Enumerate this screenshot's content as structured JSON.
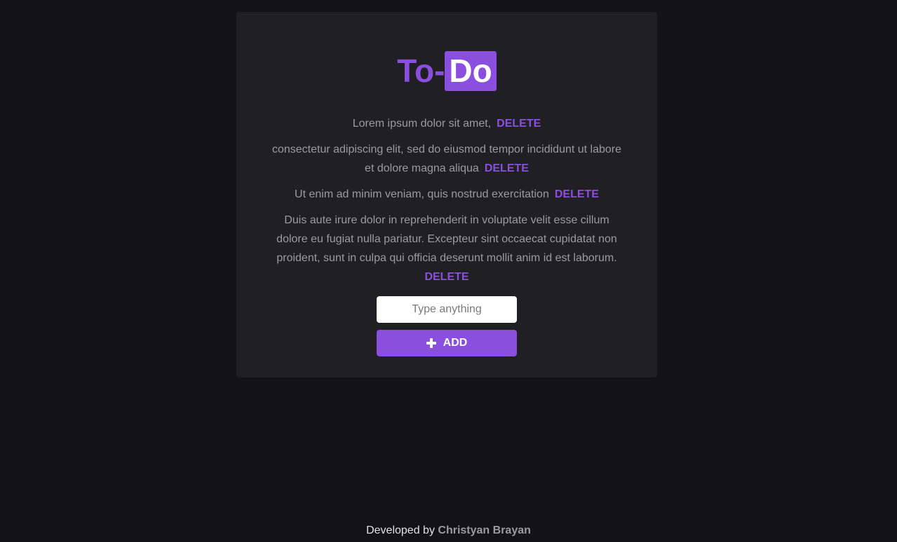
{
  "logo": {
    "part1": "To-",
    "part2": "Do"
  },
  "todos": [
    {
      "text": "Lorem ipsum dolor sit amet,",
      "delete_label": "DELETE"
    },
    {
      "text": "consectetur adipiscing elit, sed do eiusmod tempor incididunt ut labore et dolore magna aliqua",
      "delete_label": "DELETE"
    },
    {
      "text": "Ut enim ad minim veniam, quis nostrud exercitation",
      "delete_label": "DELETE"
    },
    {
      "text": "Duis aute irure dolor in reprehenderit in voluptate velit esse cillum dolore eu fugiat nulla pariatur. Excepteur sint occaecat cupidatat non proident, sunt in culpa qui officia deserunt mollit anim id est laborum.",
      "delete_label": "DELETE"
    }
  ],
  "input": {
    "placeholder": "Type anything",
    "value": ""
  },
  "add_button": {
    "label": "ADD",
    "icon": "plus-icon"
  },
  "footer": {
    "prefix": "Developed by ",
    "author": "Christyan Brayan"
  },
  "colors": {
    "accent": "#8a4fde",
    "background": "#131316",
    "card": "#202024"
  }
}
